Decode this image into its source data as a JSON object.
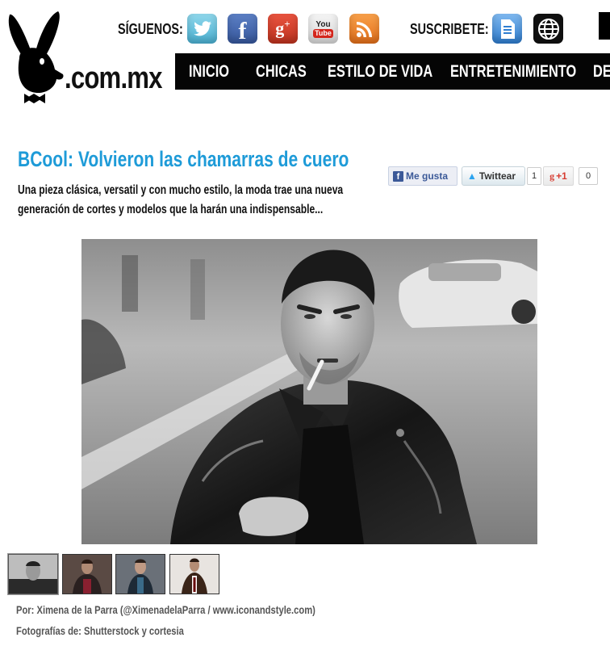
{
  "site": {
    "domain_text": ".com.mx"
  },
  "header": {
    "follow_label": "SÍGUENOS:",
    "subscribe_label": "SUSCRIBETE:",
    "follow_icons": [
      "twitter-icon",
      "facebook-icon",
      "google-plus-icon",
      "youtube-icon",
      "rss-icon"
    ],
    "subscribe_icons": [
      "newsletter-icon",
      "web-icon"
    ]
  },
  "nav": {
    "items": [
      {
        "label": "INICIO"
      },
      {
        "label": "CHICAS"
      },
      {
        "label": "ESTILO DE VIDA"
      },
      {
        "label": "ENTRETENIMIENTO"
      },
      {
        "label": "DE"
      }
    ]
  },
  "article": {
    "title": "BCool: Volvieron las chamarras de cuero",
    "summary": "Una pieza clásica, versatil y con mucho estilo, la moda trae una nueva generación de cortes y modelos que la harán una indispensable...",
    "author_credit": "Por: Ximena de la Parra (@XimenadelaParra / www.iconandstyle.com)",
    "photo_credit": "Fotografías de: Shutterstock y cortesia"
  },
  "share": {
    "facebook_label": "Me gusta",
    "twitter_label": "Twittear",
    "twitter_count": "1",
    "gplus_label": "+1",
    "gplus_count": "0"
  },
  "gallery": {
    "thumbnails": [
      {
        "name": "thumbnail-1",
        "active": true
      },
      {
        "name": "thumbnail-2",
        "active": false
      },
      {
        "name": "thumbnail-3",
        "active": false
      },
      {
        "name": "thumbnail-4",
        "active": false
      }
    ]
  },
  "colors": {
    "title_blue": "#1e9bd8",
    "nav_bg": "#050505"
  }
}
